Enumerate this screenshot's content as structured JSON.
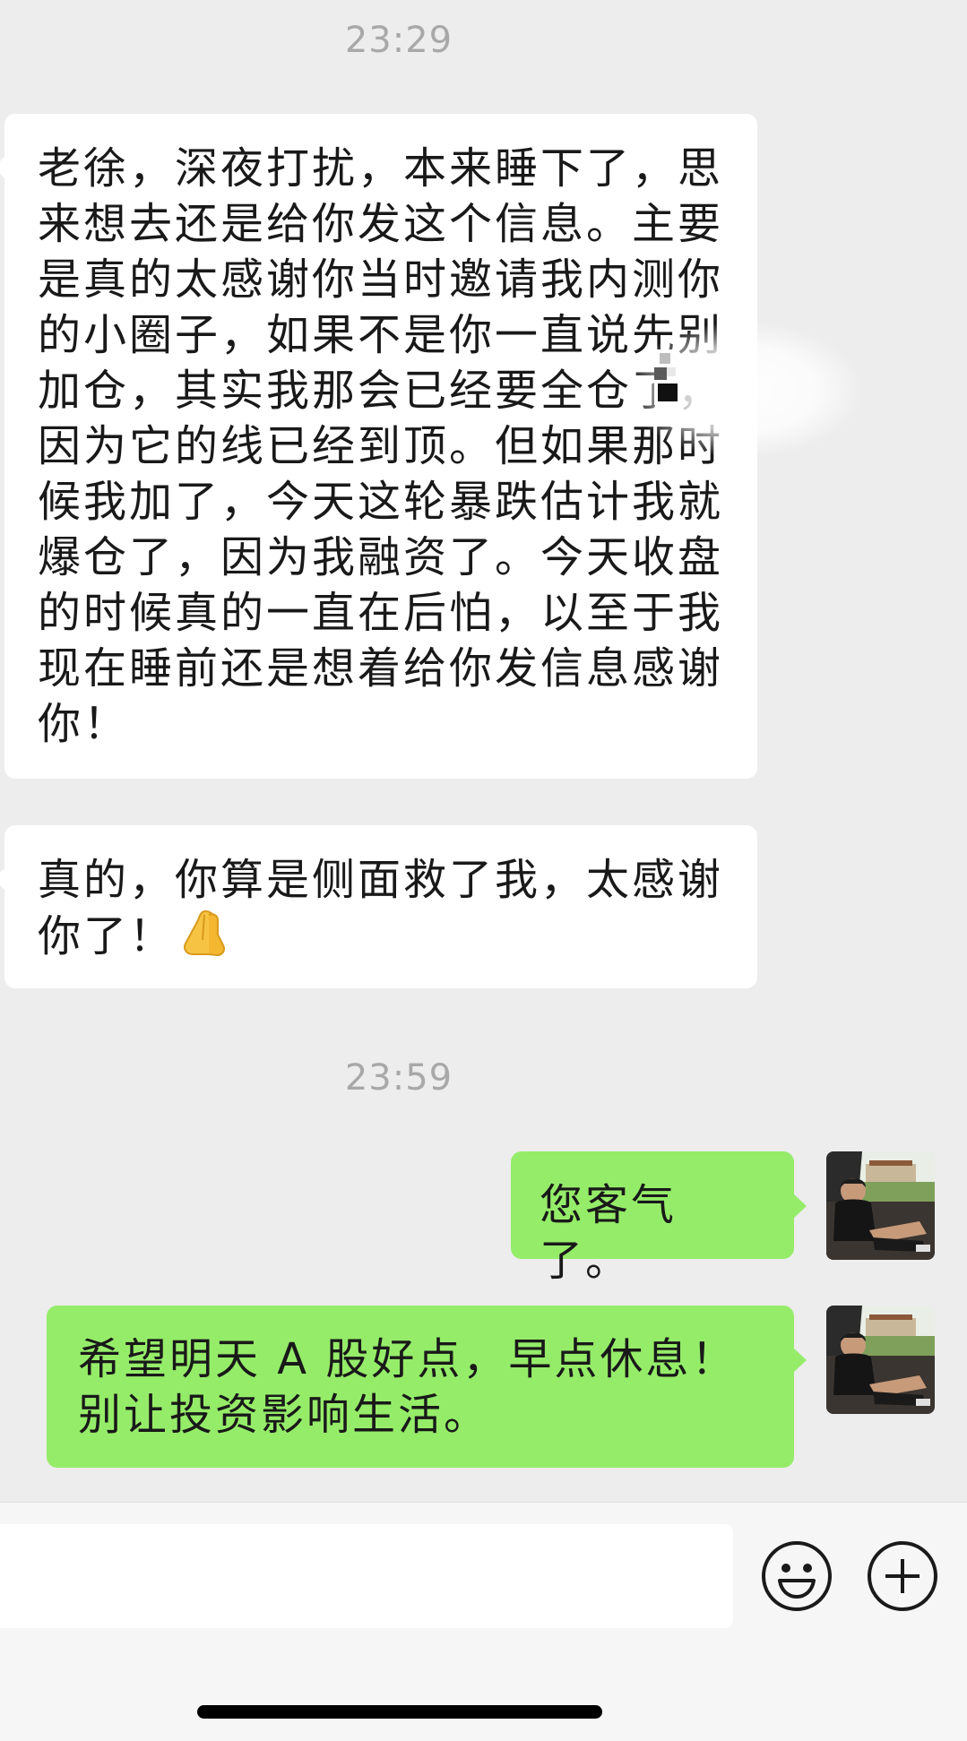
{
  "chat": {
    "timestamps": [
      "23:29",
      "23:59"
    ],
    "incoming": [
      {
        "text": "老徐，深夜打扰，本来睡下了，思来想去还是给你发这个信息。主要是真的太感谢你当时邀请我内测你的小圈子，如果不是你一直说先别加仓，其实我那会已经要全仓了，因为它的线已经到顶。但如果那时候我加了，今天这轮暴跌估计我就爆仓了，因为我融资了。今天收盘的时候真的一直在后怕，以至于我现在睡前还是想着给你发信息感谢你！"
      },
      {
        "text": "真的，你算是侧面救了我，太感谢你了！",
        "emoji": "folded-hands-emoji"
      }
    ],
    "outgoing": [
      {
        "text": "您客气了。"
      },
      {
        "text": "希望明天 A 股好点，早点休息！别让投资影响生活。"
      }
    ]
  },
  "input_bar": {
    "value": "",
    "placeholder": "",
    "emoji_icon": "smiley-icon",
    "plus_icon": "plus-circle-icon"
  },
  "colors": {
    "background": "#ededed",
    "incoming_bubble": "#ffffff",
    "outgoing_bubble": "#95ec69",
    "timestamp": "#a8a8a8",
    "text": "#191919"
  }
}
